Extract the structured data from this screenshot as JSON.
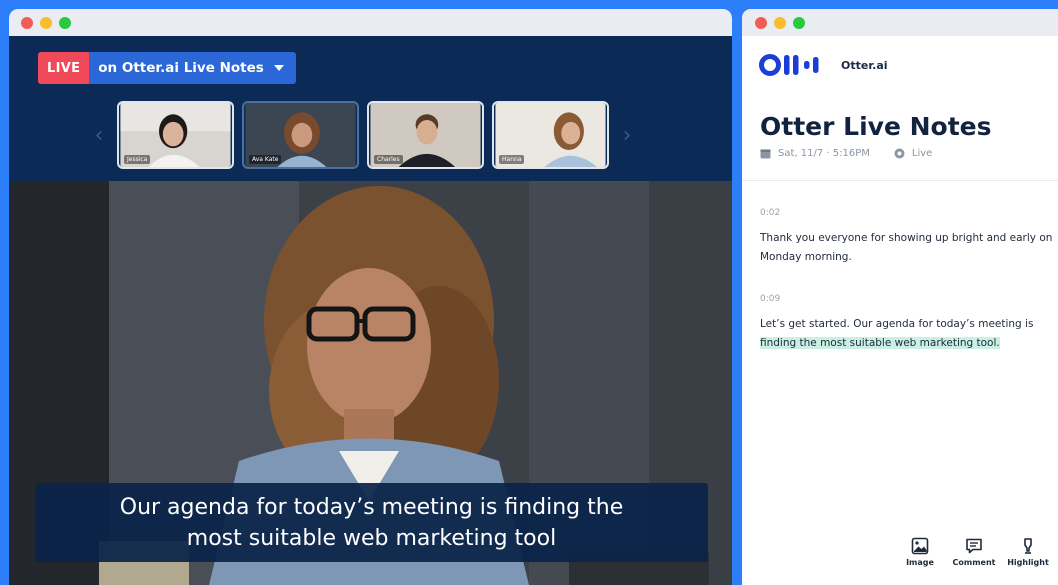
{
  "meeting": {
    "live_badge": "LIVE",
    "live_source": "on Otter.ai Live Notes",
    "participants": [
      {
        "name": "Jessica"
      },
      {
        "name": "Ava Kate"
      },
      {
        "name": "Charles"
      },
      {
        "name": "Hanna"
      }
    ],
    "caption_line1": "Our agenda for today’s meeting is finding the",
    "caption_line2": "most suitable web marketing tool"
  },
  "notes": {
    "brand_name": "Otter.ai",
    "title": "Otter Live Notes",
    "date": "Sat, 11/7 · 5:16PM",
    "status": "Live",
    "entries": [
      {
        "timestamp": "0:02",
        "text": "Thank you everyone for showing up bright and early on Monday morning."
      },
      {
        "timestamp": "0:09",
        "text_before": "Let’s get started. Our agenda for today’s meeting is ",
        "highlight": "finding the most suitable web marketing tool."
      }
    ],
    "actions": [
      {
        "label": "Image",
        "icon": "image-icon"
      },
      {
        "label": "Comment",
        "icon": "comment-icon"
      },
      {
        "label": "Highlight",
        "icon": "highlighter-icon"
      }
    ]
  },
  "colors": {
    "background": "#2d7ff9",
    "meeting_bg": "#0b2a55",
    "live_red": "#f0495a",
    "live_blue": "#2c67d8",
    "highlight_green": "#c9f0e2"
  }
}
